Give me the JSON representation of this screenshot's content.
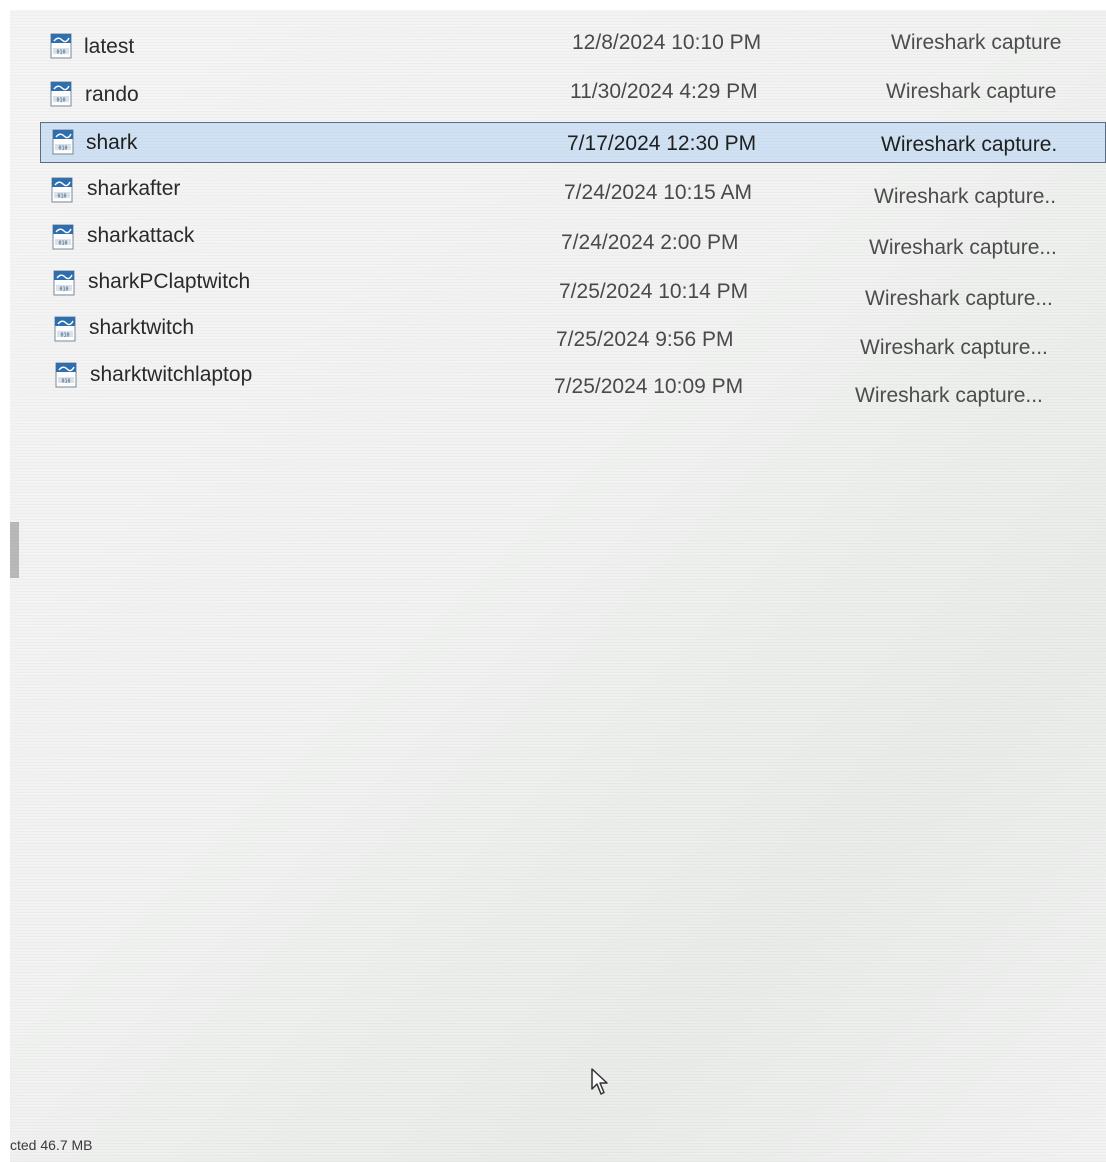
{
  "files": [
    {
      "name": "latest",
      "date": "12/8/2024 10:10 PM",
      "type": "Wireshark capture",
      "selected": false,
      "icon": "wireshark-file-icon"
    },
    {
      "name": "rando",
      "date": "11/30/2024 4:29 PM",
      "type": "Wireshark capture",
      "selected": false,
      "icon": "wireshark-file-icon"
    },
    {
      "name": "shark",
      "date": "7/17/2024 12:30 PM",
      "type": "Wireshark capture.",
      "selected": true,
      "icon": "wireshark-file-icon"
    },
    {
      "name": "sharkafter",
      "date": "7/24/2024 10:15 AM",
      "type": "Wireshark capture..",
      "selected": false,
      "icon": "wireshark-file-icon"
    },
    {
      "name": "sharkattack",
      "date": "7/24/2024 2:00 PM",
      "type": "Wireshark capture...",
      "selected": false,
      "icon": "wireshark-file-icon"
    },
    {
      "name": "sharkPClaptwitch",
      "date": "7/25/2024 10:14 PM",
      "type": "Wireshark capture...",
      "selected": false,
      "icon": "wireshark-file-icon"
    },
    {
      "name": "sharktwitch",
      "date": "7/25/2024 9:56 PM",
      "type": "Wireshark capture...",
      "selected": false,
      "icon": "wireshark-file-icon"
    },
    {
      "name": "sharktwitchlaptop",
      "date": "7/25/2024 10:09 PM",
      "type": "Wireshark capture...",
      "selected": false,
      "icon": "wireshark-file-icon"
    }
  ],
  "status": {
    "text": "cted  46.7 MB"
  },
  "colors": {
    "selection_fill": "#cfe1f3",
    "selection_border": "#5b6f85",
    "icon_blue": "#2f6fb0"
  }
}
